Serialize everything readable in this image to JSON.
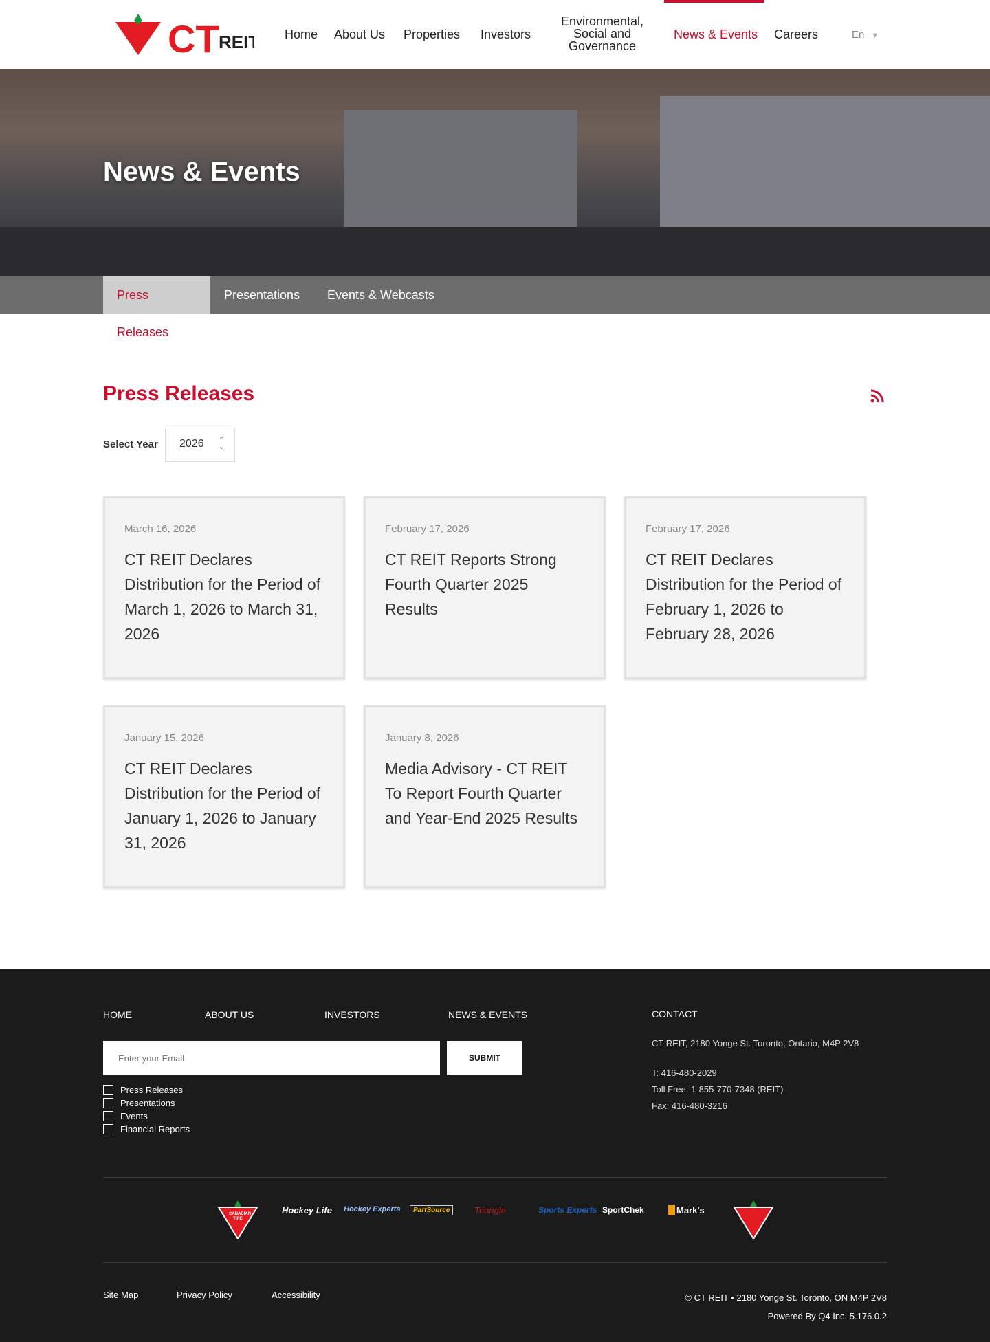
{
  "header": {
    "logo": "CT REIT",
    "nav": [
      "Home",
      "About Us",
      "Properties",
      "Investors",
      "Environmental, Social and Governance",
      "News & Events",
      "Careers"
    ],
    "language": "En"
  },
  "hero": {
    "title": "News & Events"
  },
  "subnav": [
    "Press Releases",
    "Presentations",
    "Events & Webcasts"
  ],
  "main": {
    "title": "Press Releases",
    "year_label": "Select Year",
    "year_value": "2026",
    "cards": [
      {
        "date": "March 16, 2026",
        "title": "CT REIT Declares Distribution for the Period of March 1, 2026 to March 31, 2026"
      },
      {
        "date": "February 17, 2026",
        "title": "CT REIT Reports Strong Fourth Quarter 2025 Results"
      },
      {
        "date": "February 17, 2026",
        "title": "CT REIT Declares Distribution for the Period of February 1, 2026 to February 28, 2026"
      },
      {
        "date": "January 15, 2026",
        "title": "CT REIT Declares Distribution for the Period of January 1, 2026 to January 31, 2026"
      },
      {
        "date": "January 8, 2026",
        "title": "Media Advisory - CT REIT To Report Fourth Quarter and Year-End 2025 Results"
      }
    ]
  },
  "footer": {
    "links": [
      "HOME",
      "ABOUT US",
      "INVESTORS",
      "NEWS & EVENTS"
    ],
    "email_placeholder": "Enter your Email",
    "submit": "SUBMIT",
    "checkboxes": [
      "Press Releases",
      "Presentations",
      "Events",
      "Financial Reports"
    ],
    "contact_title": "CONTACT",
    "address": "CT REIT, 2180 Yonge St. Toronto, Ontario, M4P 2V8",
    "phone": "T: 416-480-2029",
    "tollfree": "Toll Free: 1-855-770-7348 (REIT)",
    "fax": "Fax: 416-480-3216",
    "brands": [
      "Canadian Tire",
      "Hockey Life",
      "Hockey Experts",
      "PartSource",
      "Triangle",
      "Sports Experts",
      "SportChek",
      "Mark's",
      "Canadian Tire"
    ],
    "bottom_links": [
      "Site Map",
      "Privacy Policy",
      "Accessibility"
    ],
    "copyright": "© CT REIT • 2180 Yonge St. Toronto, ON M4P 2V8",
    "powered": "Powered By Q4 Inc. 5.176.0.2"
  }
}
